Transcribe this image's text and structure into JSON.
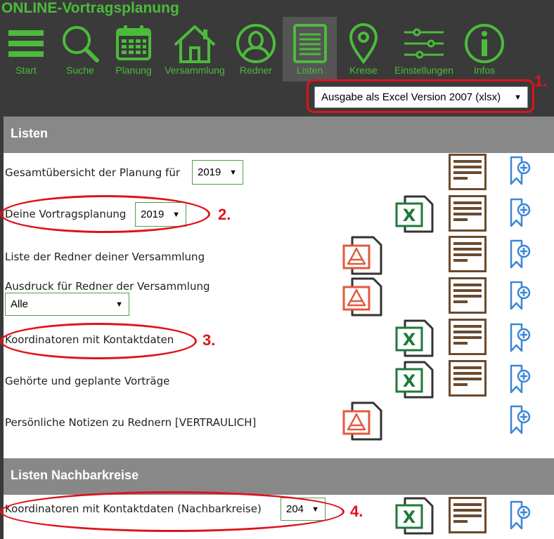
{
  "app": {
    "title": "ONLINE-Vortragsplanung"
  },
  "colors": {
    "accent": "#4cbb3c",
    "header_bg": "#3a3a3a",
    "section_bg": "#888888",
    "doc_icon": "#6b4a2f",
    "bookmark_icon": "#3a86d8",
    "annotation": "#e0121a"
  },
  "nav": {
    "items": [
      {
        "label": "Start",
        "icon": "hamburger-icon"
      },
      {
        "label": "Suche",
        "icon": "search-icon"
      },
      {
        "label": "Planung",
        "icon": "calendar-icon"
      },
      {
        "label": "Versammlung",
        "icon": "house-icon"
      },
      {
        "label": "Redner",
        "icon": "person-icon"
      },
      {
        "label": "Listen",
        "icon": "list-icon",
        "active": true
      },
      {
        "label": "Kreise",
        "icon": "location-pin-icon"
      },
      {
        "label": "Einstellungen",
        "icon": "sliders-icon"
      },
      {
        "label": "Infos",
        "icon": "info-icon"
      }
    ]
  },
  "output_format": {
    "selected": "Ausgabe als Excel Version 2007 (xlsx)"
  },
  "sections": {
    "lists": {
      "title": "Listen",
      "rows": [
        {
          "label": "Gesamtübersicht der Planung für",
          "select": "2019",
          "actions": [
            "document",
            "bookmark-add"
          ]
        },
        {
          "label": "Deine Vortragsplanung",
          "select": "2019",
          "actions": [
            "excel",
            "document",
            "bookmark-add"
          ]
        },
        {
          "label": "Liste der Redner deiner Versammlung",
          "actions": [
            "pdf",
            "document",
            "bookmark-add"
          ]
        },
        {
          "label": "Ausdruck für Redner der Versammlung",
          "select": "Alle",
          "actions": [
            "pdf",
            "document",
            "bookmark-add"
          ]
        },
        {
          "label": "Koordinatoren mit Kontaktdaten",
          "actions": [
            "excel",
            "document",
            "bookmark-add"
          ]
        },
        {
          "label": "Gehörte und geplante Vorträge",
          "actions": [
            "excel",
            "document",
            "bookmark-add"
          ]
        },
        {
          "label": "Persönliche Notizen zu Rednern [VERTRAULICH]",
          "actions": [
            "pdf",
            "bookmark-add"
          ]
        }
      ]
    },
    "neighbor": {
      "title": "Listen Nachbarkreise",
      "rows": [
        {
          "label": "Koordinatoren mit Kontaktdaten (Nachbarkreise)",
          "select": "204",
          "actions": [
            "excel",
            "document",
            "bookmark-add"
          ]
        }
      ]
    }
  },
  "annotations": [
    "1.",
    "2.",
    "3.",
    "4."
  ]
}
